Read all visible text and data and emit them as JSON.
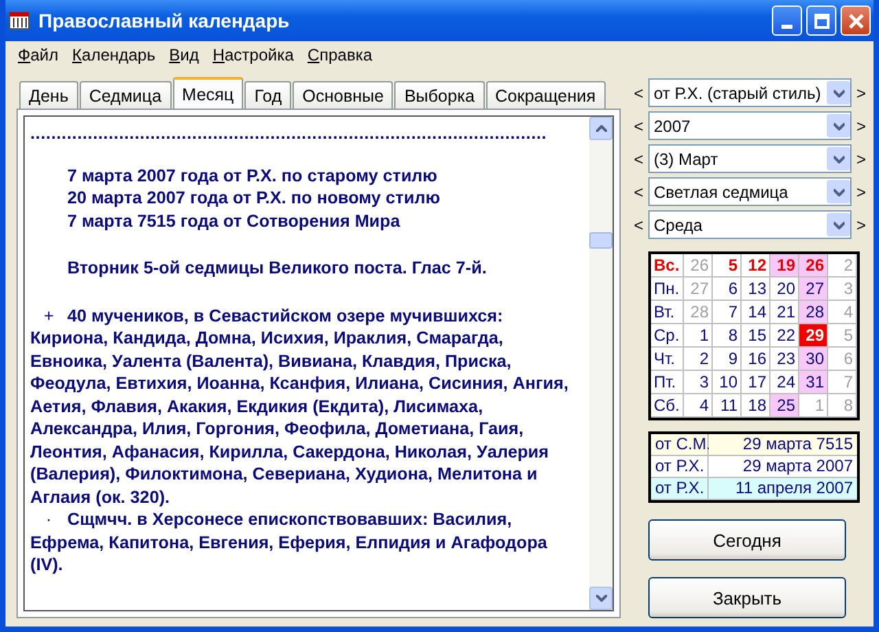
{
  "window": {
    "title": "Православный календарь"
  },
  "menu": [
    "Файл",
    "Календарь",
    "Вид",
    "Настройка",
    "Справка"
  ],
  "tabs": [
    {
      "label": "День",
      "selected": false
    },
    {
      "label": "Седмица",
      "selected": false
    },
    {
      "label": "Месяц",
      "selected": true
    },
    {
      "label": "Год",
      "selected": false
    },
    {
      "label": "Основные",
      "selected": false
    },
    {
      "label": "Выборка",
      "selected": false
    },
    {
      "label": "Сокращения",
      "selected": false
    }
  ],
  "content": {
    "separator": "...................................................................................................",
    "dates": [
      "7 марта 2007 года от Р.Х. по старому стилю",
      "20 марта 2007 года от Р.Х. по новому стилю",
      "7 марта 7515 года от Сотворения Мира"
    ],
    "day_line": "Вторник 5-ой седмицы Великого поста. Глас 7-й.",
    "entries": [
      {
        "mark": "+",
        "text": "40 мучеников, в Севастийском озере мучившихся: Кириона, Кандида, Домна, Исихия, Ираклия, Смарагда, Евноика, Уалента (Валента), Вивиана, Клавдия, Приска, Феодула, Евтихия, Иоанна, Ксанфия, Илиана, Сисиния, Ангия, Аетия, Флавия, Акакия, Екдикия (Екдита), Лисимаха, Александра, Илия, Горгония, Феофила, Дометиана, Гаия, Леонтия, Афанасия, Кирилла, Сакердона, Николая, Уалерия (Валерия), Филоктимона, Севериана, Худиона, Мелитона и Аглаия (ок. 320)."
      },
      {
        "mark": "·",
        "text": "Сщмчч. в Херсонесе епископствовавших: Василия, Ефрема, Капитона, Евгения, Еферия, Елпидия и Агафодора (IV)."
      }
    ]
  },
  "selectors": [
    {
      "prev": "<",
      "value": "от Р.Х. (старый стиль)",
      "next": ">"
    },
    {
      "prev": "<",
      "value": "2007",
      "next": ">"
    },
    {
      "prev": "<",
      "value": "(3) Март",
      "next": ">"
    },
    {
      "prev": "<",
      "value": "Светлая седмица",
      "next": ">"
    },
    {
      "prev": "<",
      "value": "Среда",
      "next": ">"
    }
  ],
  "calendar": [
    {
      "day": "Вс.",
      "kind": "holiday",
      "cells": [
        {
          "text": "26",
          "kind": "other",
          "highlighted": false,
          "selected": false
        },
        {
          "text": "5",
          "kind": "holiday",
          "highlighted": false,
          "selected": false
        },
        {
          "text": "12",
          "kind": "holiday",
          "highlighted": false,
          "selected": false
        },
        {
          "text": "19",
          "kind": "holiday",
          "highlighted": true,
          "selected": false
        },
        {
          "text": "26",
          "kind": "holiday",
          "highlighted": true,
          "selected": false
        },
        {
          "text": "2",
          "kind": "other",
          "highlighted": false,
          "selected": false
        }
      ]
    },
    {
      "day": "Пн.",
      "kind": "day",
      "cells": [
        {
          "text": "27",
          "kind": "other",
          "highlighted": false,
          "selected": false
        },
        {
          "text": "6",
          "kind": "day",
          "highlighted": false,
          "selected": false
        },
        {
          "text": "13",
          "kind": "day",
          "highlighted": false,
          "selected": false
        },
        {
          "text": "20",
          "kind": "day",
          "highlighted": false,
          "selected": false
        },
        {
          "text": "27",
          "kind": "day",
          "highlighted": true,
          "selected": false
        },
        {
          "text": "3",
          "kind": "other",
          "highlighted": false,
          "selected": false
        }
      ]
    },
    {
      "day": "Вт.",
      "kind": "day",
      "cells": [
        {
          "text": "28",
          "kind": "other",
          "highlighted": false,
          "selected": false
        },
        {
          "text": "7",
          "kind": "day",
          "highlighted": false,
          "selected": false
        },
        {
          "text": "14",
          "kind": "day",
          "highlighted": false,
          "selected": false
        },
        {
          "text": "21",
          "kind": "day",
          "highlighted": false,
          "selected": false
        },
        {
          "text": "28",
          "kind": "day",
          "highlighted": true,
          "selected": false
        },
        {
          "text": "4",
          "kind": "other",
          "highlighted": false,
          "selected": false
        }
      ]
    },
    {
      "day": "Ср.",
      "kind": "day",
      "cells": [
        {
          "text": "1",
          "kind": "day",
          "highlighted": false,
          "selected": false
        },
        {
          "text": "8",
          "kind": "day",
          "highlighted": false,
          "selected": false
        },
        {
          "text": "15",
          "kind": "day",
          "highlighted": false,
          "selected": false
        },
        {
          "text": "22",
          "kind": "day",
          "highlighted": false,
          "selected": false
        },
        {
          "text": "29",
          "kind": "day",
          "highlighted": false,
          "selected": true
        },
        {
          "text": "5",
          "kind": "other",
          "highlighted": false,
          "selected": false
        }
      ]
    },
    {
      "day": "Чт.",
      "kind": "day",
      "cells": [
        {
          "text": "2",
          "kind": "day",
          "highlighted": false,
          "selected": false
        },
        {
          "text": "9",
          "kind": "day",
          "highlighted": false,
          "selected": false
        },
        {
          "text": "16",
          "kind": "day",
          "highlighted": false,
          "selected": false
        },
        {
          "text": "23",
          "kind": "day",
          "highlighted": false,
          "selected": false
        },
        {
          "text": "30",
          "kind": "day",
          "highlighted": true,
          "selected": false
        },
        {
          "text": "6",
          "kind": "other",
          "highlighted": false,
          "selected": false
        }
      ]
    },
    {
      "day": "Пт.",
      "kind": "day",
      "cells": [
        {
          "text": "3",
          "kind": "day",
          "highlighted": false,
          "selected": false
        },
        {
          "text": "10",
          "kind": "day",
          "highlighted": false,
          "selected": false
        },
        {
          "text": "17",
          "kind": "day",
          "highlighted": false,
          "selected": false
        },
        {
          "text": "24",
          "kind": "day",
          "highlighted": false,
          "selected": false
        },
        {
          "text": "31",
          "kind": "day",
          "highlighted": true,
          "selected": false
        },
        {
          "text": "7",
          "kind": "other",
          "highlighted": false,
          "selected": false
        }
      ]
    },
    {
      "day": "Сб.",
      "kind": "day",
      "cells": [
        {
          "text": "4",
          "kind": "day",
          "highlighted": false,
          "selected": false
        },
        {
          "text": "11",
          "kind": "day",
          "highlighted": false,
          "selected": false
        },
        {
          "text": "18",
          "kind": "day",
          "highlighted": false,
          "selected": false
        },
        {
          "text": "25",
          "kind": "day",
          "highlighted": true,
          "selected": false
        },
        {
          "text": "1",
          "kind": "other",
          "highlighted": false,
          "selected": false
        },
        {
          "text": "8",
          "kind": "other",
          "highlighted": false,
          "selected": false
        }
      ]
    }
  ],
  "date_table": [
    {
      "label": "от С.М.",
      "value": "29 марта 7515",
      "color": "#fffde4"
    },
    {
      "label": "от Р.Х.",
      "value": "29 марта 2007",
      "color": "#ffffff"
    },
    {
      "label": "от Р.Х.",
      "value": "11 апреля 2007",
      "color": "#d8fcfc"
    }
  ],
  "buttons": [
    "Сегодня",
    "Закрыть"
  ]
}
